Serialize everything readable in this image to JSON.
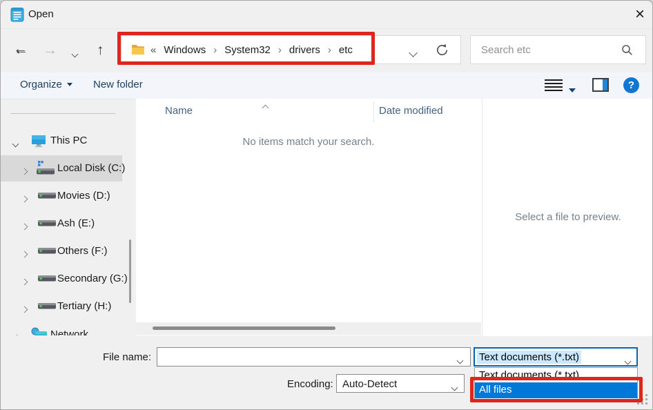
{
  "titlebar": {
    "title": "Open",
    "close_glyph": "×"
  },
  "nav": {
    "back_glyph": "←",
    "forward_glyph": "→",
    "up_glyph": "↑",
    "overflow_glyph": "«",
    "separator_glyph": "›"
  },
  "address": {
    "segments": [
      "Windows",
      "System32",
      "drivers",
      "etc"
    ]
  },
  "search": {
    "placeholder": "Search etc"
  },
  "toolbar": {
    "organize_label": "Organize",
    "new_folder_label": "New folder"
  },
  "sidebar": {
    "items": [
      {
        "label": "This PC",
        "expanded": true
      },
      {
        "label": "Local Disk (C:)",
        "selected": true
      },
      {
        "label": "Movies (D:)"
      },
      {
        "label": "Ash (E:)"
      },
      {
        "label": "Others (F:)"
      },
      {
        "label": "Secondary (G:)"
      },
      {
        "label": "Tertiary (H:)"
      },
      {
        "label": "Network"
      }
    ]
  },
  "file_list": {
    "columns": [
      {
        "label": "Name"
      },
      {
        "label": "Date modified"
      }
    ],
    "empty_message": "No items match your search."
  },
  "preview": {
    "message": "Select a file to preview."
  },
  "footer": {
    "file_name_label": "File name:",
    "file_name_value": "",
    "file_type_selected": "Text documents (*.txt)",
    "file_type_options": [
      "Text documents (*.txt)",
      "All files"
    ],
    "highlighted_option": "All files",
    "encoding_label": "Encoding:",
    "encoding_value": "Auto-Detect"
  },
  "colors": {
    "accent_blue": "#0078d7",
    "focus_border_blue": "#0066b8",
    "selection_light_blue": "#cce8ff",
    "annotation_red": "#e0251d",
    "selected_item_gray": "#d9d9d9"
  }
}
